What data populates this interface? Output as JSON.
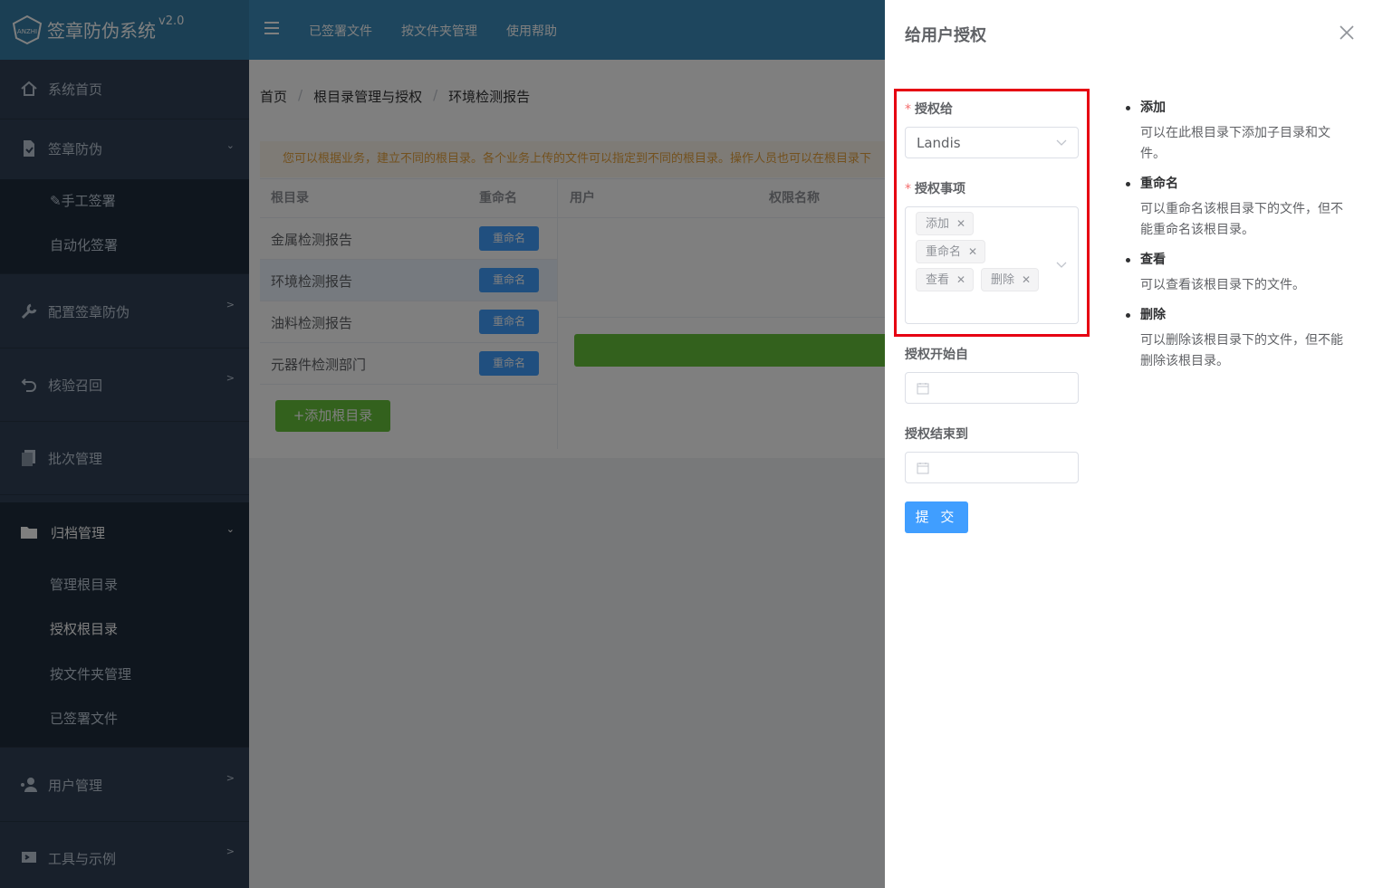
{
  "header": {
    "app_title": "签章防伪系统",
    "version": "v2.0",
    "logo_text": "ANZHI",
    "nav": [
      "已签署文件",
      "按文件夹管理",
      "使用帮助"
    ]
  },
  "sidebar": {
    "items": [
      {
        "label": "系统首页",
        "icon": "home-icon"
      },
      {
        "label": "签章防伪",
        "icon": "document-icon"
      },
      {
        "label": "配置签章防伪",
        "icon": "wrench-icon"
      },
      {
        "label": "核验召回",
        "icon": "undo-icon"
      },
      {
        "label": "批次管理",
        "icon": "files-icon"
      },
      {
        "label": "归档管理",
        "icon": "folder-icon"
      },
      {
        "label": "用户管理",
        "icon": "users-icon"
      },
      {
        "label": "工具与示例",
        "icon": "tools-icon"
      }
    ],
    "sub_sign": [
      "手工签署",
      "自动化签署"
    ],
    "sub_archive": [
      "管理根目录",
      "授权根目录",
      "按文件夹管理",
      "已签署文件"
    ]
  },
  "breadcrumb": [
    "首页",
    "根目录管理与授权",
    "环境检测报告"
  ],
  "notice": "您可以根据业务，建立不同的根目录。各个业务上传的文件可以指定到不同的根目录。操作人员也可以在根目录下",
  "table": {
    "headers": {
      "root": "根目录",
      "rename": "重命名",
      "user": "用户",
      "perm": "权限名称"
    },
    "rows": [
      "金属检测报告",
      "环境检测报告",
      "油料检测报告",
      "元器件检测部门"
    ],
    "rename_label": "重命名",
    "add_label": "+添加根目录"
  },
  "drawer": {
    "title": "给用户授权",
    "grant_to_label": "授权给",
    "grant_to_value": "Landis",
    "items_label": "授权事项",
    "tags": [
      "添加",
      "重命名",
      "查看",
      "删除"
    ],
    "start_label": "授权开始自",
    "end_label": "授权结束到",
    "submit_label": "提 交",
    "help": [
      {
        "title": "添加",
        "desc": "可以在此根目录下添加子目录和文件。"
      },
      {
        "title": "重命名",
        "desc": "可以重命名该根目录下的文件，但不能重命名该根目录。"
      },
      {
        "title": "查看",
        "desc": "可以查看该根目录下的文件。"
      },
      {
        "title": "删除",
        "desc": "可以删除该根目录下的文件，但不能删除该根目录。"
      }
    ]
  },
  "colors": {
    "header": "#3c8dbc",
    "sidebar": "#304156",
    "primary": "#409eff",
    "success": "#67c23a",
    "highlight": "#e60012"
  }
}
